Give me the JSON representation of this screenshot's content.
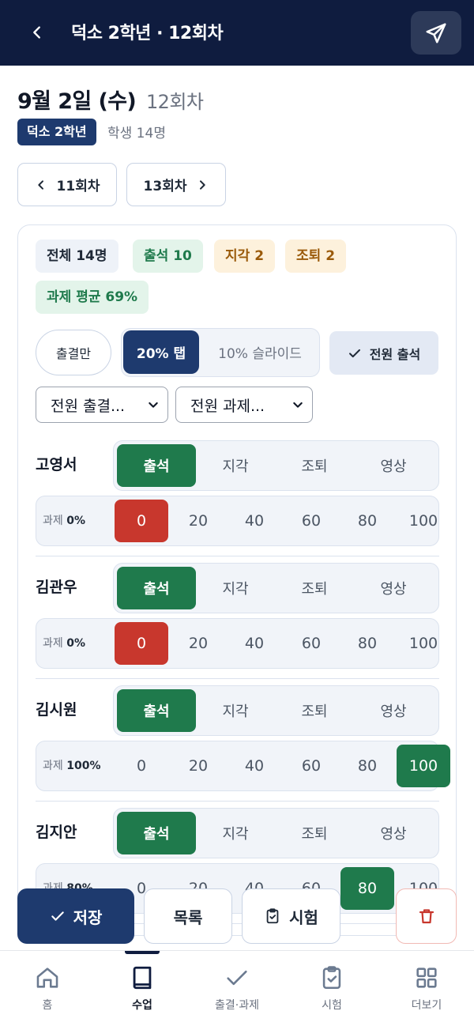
{
  "header": {
    "title": "덕소 2학년 · 12회차",
    "back_icon": "chevron-left-icon",
    "send_icon": "send-icon"
  },
  "session": {
    "date": "9월 2일 (수)",
    "session_label": "12회차",
    "class_badge": "덕소 2학년",
    "student_count": "학생 14명"
  },
  "nav": {
    "prev_label": "11회차",
    "next_label": "13회차"
  },
  "stats": {
    "total": "전체 14명",
    "present": "출석 10",
    "late": "지각 2",
    "early_leave": "조퇴 2",
    "hw_average": "과제 평균 69%"
  },
  "mode": {
    "attendance_only": "출결만",
    "tap": "20% 탭",
    "slide": "10% 슬라이드",
    "all_present": "전원 출석"
  },
  "selects": {
    "all_attendance": "전원 출결...",
    "all_homework": "전원 과제..."
  },
  "attendance_options": [
    "출석",
    "지각",
    "조퇴",
    "영상"
  ],
  "homework_options": [
    "0",
    "20",
    "40",
    "60",
    "80",
    "100"
  ],
  "homework_label": "과제",
  "students": [
    {
      "name": "고영서",
      "attendance": "출석",
      "homework_pct": "0%",
      "homework": "0"
    },
    {
      "name": "김관우",
      "attendance": "출석",
      "homework_pct": "0%",
      "homework": "0"
    },
    {
      "name": "김시원",
      "attendance": "출석",
      "homework_pct": "100%",
      "homework": "100"
    },
    {
      "name": "김지안",
      "attendance": "출석",
      "homework_pct": "80%",
      "homework": "80"
    }
  ],
  "actions": {
    "save": "저장",
    "list": "목록",
    "exam": "시험"
  },
  "tabs": [
    {
      "label": "홈",
      "icon": "home-icon"
    },
    {
      "label": "수업",
      "icon": "book-icon"
    },
    {
      "label": "출결·과제",
      "icon": "check-icon"
    },
    {
      "label": "시험",
      "icon": "clipboard-check-icon"
    },
    {
      "label": "더보기",
      "icon": "grid-icon"
    }
  ],
  "active_tab": "수업",
  "colors": {
    "navy": "#0f1c3f",
    "primary": "#1e3a6e",
    "green": "#1f7a4c",
    "red": "#c8372d",
    "amber": "#9a5a0a"
  }
}
